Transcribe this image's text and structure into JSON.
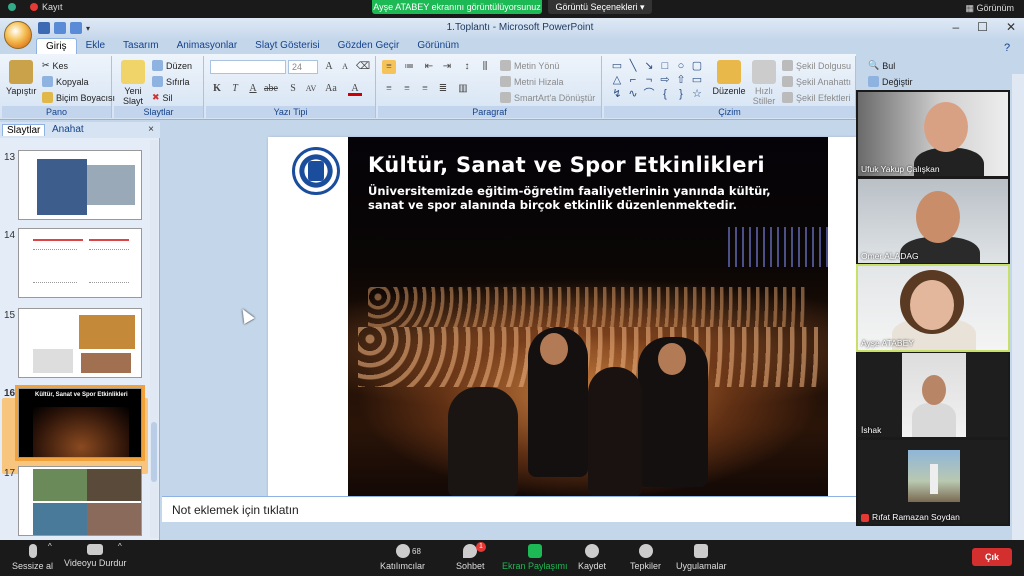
{
  "zoom_top": {
    "record_label": "Kayıt",
    "share_banner": "Ayşe ATABEY ekranını görüntülüyorsunuz",
    "view_options": "Görüntü Seçenekleri ▾",
    "view_label": "Görünüm"
  },
  "window": {
    "title": "1.Toplantı - Microsoft PowerPoint",
    "controls": [
      "–",
      "☐",
      "✕"
    ]
  },
  "ribbon_tabs": [
    "Giriş",
    "Ekle",
    "Tasarım",
    "Animasyonlar",
    "Slayt Gösterisi",
    "Gözden Geçir",
    "Görünüm"
  ],
  "ribbon": {
    "clipboard": {
      "label": "Pano",
      "paste": "Yapıştır",
      "cut": "Kes",
      "copy": "Kopyala",
      "format_painter": "Biçim Boyacısı"
    },
    "slides": {
      "label": "Slaytlar",
      "new_slide": "Yeni Slayt",
      "layout": "Düzen",
      "reset": "Sıfırla",
      "delete": "Sil"
    },
    "font": {
      "label": "Yazı Tipi",
      "font_name": "",
      "font_size": "24"
    },
    "paragraph": {
      "label": "Paragraf",
      "text_direction": "Metin Yönü",
      "align_text": "Metni Hizala",
      "smartart": "SmartArt'a Dönüştür"
    },
    "drawing": {
      "label": "Çizim",
      "arrange": "Düzenle",
      "quick_styles": "Hızlı Stiller",
      "shape_fill": "Şekil Dolgusu",
      "shape_outline": "Şekil Anahattı",
      "shape_effects": "Şekil Efektleri"
    },
    "editing": {
      "find": "Bul",
      "replace": "Değiştir"
    }
  },
  "slide_panel": {
    "tab_slides": "Slaytlar",
    "tab_outline": "Anahat",
    "close": "×",
    "thumb_numbers": [
      "13",
      "14",
      "15",
      "16",
      "17"
    ],
    "thumb16_title": "Kültür, Sanat ve Spor Etkinlikleri"
  },
  "slide": {
    "title": "Kültür, Sanat ve Spor Etkinlikleri",
    "subtitle": "Üniversitemizde eğitim-öğretim faaliyetlerinin yanında kültür, sanat ve spor alanında birçok etkinlik düzenlenmektedir."
  },
  "notes_placeholder": "Not eklemek için tıklatın",
  "participants": [
    {
      "name": "Ufuk Yakup Çalışkan"
    },
    {
      "name": "Omer ALADAG"
    },
    {
      "name": "Ayşe ATABEY"
    },
    {
      "name": "İshak"
    },
    {
      "name": "Rıfat Ramazan Soydan"
    }
  ],
  "toolbar": {
    "mute": "Sessize al",
    "stop_video": "Videoyu Durdur",
    "participants": "Katılımcılar",
    "participant_count": "68",
    "chat": "Sohbet",
    "chat_badge": "1",
    "share": "Ekran Paylaşımı",
    "record": "Kaydet",
    "reactions": "Tepkiler",
    "apps": "Uygulamalar",
    "leave": "Çık"
  },
  "colors": {
    "share_green": "#1db954",
    "leave_red": "#d32f2f",
    "ribbon_blue": "#15428b",
    "active_speaker": "#c6e06a"
  }
}
